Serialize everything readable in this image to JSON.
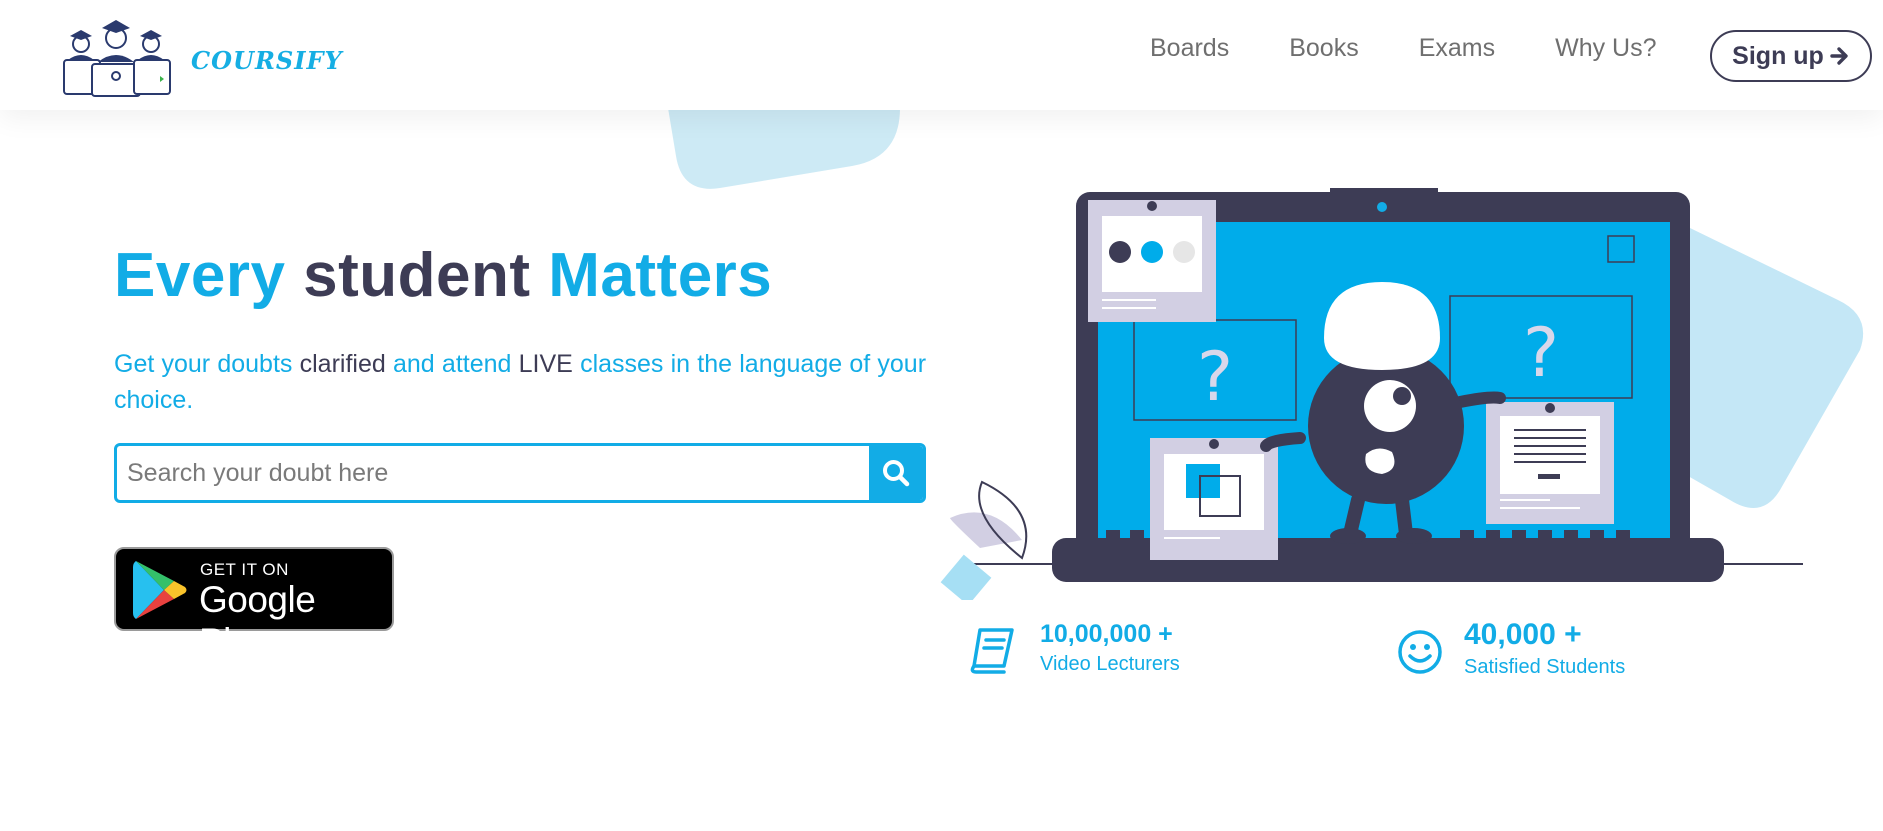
{
  "brand": {
    "name": "COURSIFY",
    "primary_color": "#12ace6",
    "dark_color": "#3d3c55"
  },
  "nav": {
    "items": [
      "Boards",
      "Books",
      "Exams",
      "Why Us?"
    ],
    "signup_label": "Sign up",
    "signup_icon": "arrow-right-icon"
  },
  "hero": {
    "headline": {
      "word1": "Every",
      "word2": "student",
      "word3": "Matters"
    },
    "subtext": {
      "p1": "Get your doubts",
      "p2": "clarified",
      "p3": "and attend",
      "p4": "LIVE",
      "p5": "classes in the language of your choice."
    },
    "search": {
      "placeholder": "Search your doubt here",
      "icon": "search-icon"
    },
    "store_badge": {
      "line1": "GET IT ON",
      "line2": "Google Play"
    }
  },
  "stats": [
    {
      "value": "10,00,000 +",
      "label": "Video Lecturers",
      "icon": "book-icon"
    },
    {
      "value": "40,000 +",
      "label": "Satisfied Students",
      "icon": "smiley-icon"
    }
  ]
}
